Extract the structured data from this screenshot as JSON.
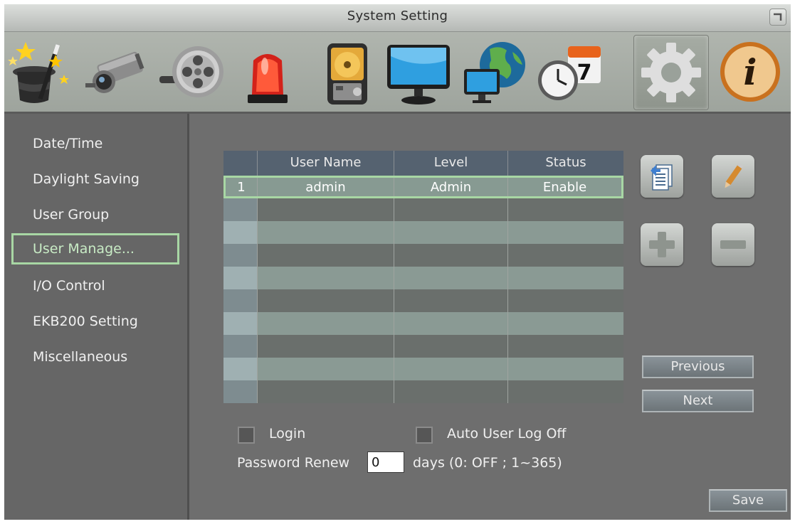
{
  "window": {
    "title": "System Setting"
  },
  "toolbar": {
    "icons": [
      "wizard-icon",
      "camera-icon",
      "record-icon",
      "alarm-icon",
      "disk-icon",
      "monitor-icon",
      "network-icon",
      "schedule-icon",
      "system-gear-icon",
      "info-icon"
    ],
    "active": "system-gear-icon"
  },
  "sidebar": {
    "items": [
      {
        "label": "Date/Time"
      },
      {
        "label": "Daylight Saving"
      },
      {
        "label": "User Group"
      },
      {
        "label": "User Manage..."
      },
      {
        "label": "I/O Control"
      },
      {
        "label": "EKB200 Setting"
      },
      {
        "label": "Miscellaneous"
      }
    ],
    "selected_index": 3
  },
  "user_table": {
    "headers": {
      "index": "",
      "user_name": "User Name",
      "level": "Level",
      "status": "Status"
    },
    "rows": [
      {
        "index": "1",
        "user_name": "admin",
        "level": "Admin",
        "status": "Enable"
      }
    ],
    "empty_rows": 9
  },
  "buttons": {
    "previous": "Previous",
    "next": "Next",
    "save": "Save"
  },
  "options": {
    "login_label": "Login",
    "login_checked": false,
    "auto_logoff_label": "Auto User Log Off",
    "auto_logoff_checked": false,
    "password_renew_label": "Password Renew",
    "password_renew_value": "0",
    "password_renew_hint": "days (0: OFF ; 1~365)"
  },
  "colors": {
    "selection": "#a8d7a4",
    "header_bg": "#556270",
    "row_light": "#8a9a94",
    "row_dark": "#6a6f6c"
  }
}
